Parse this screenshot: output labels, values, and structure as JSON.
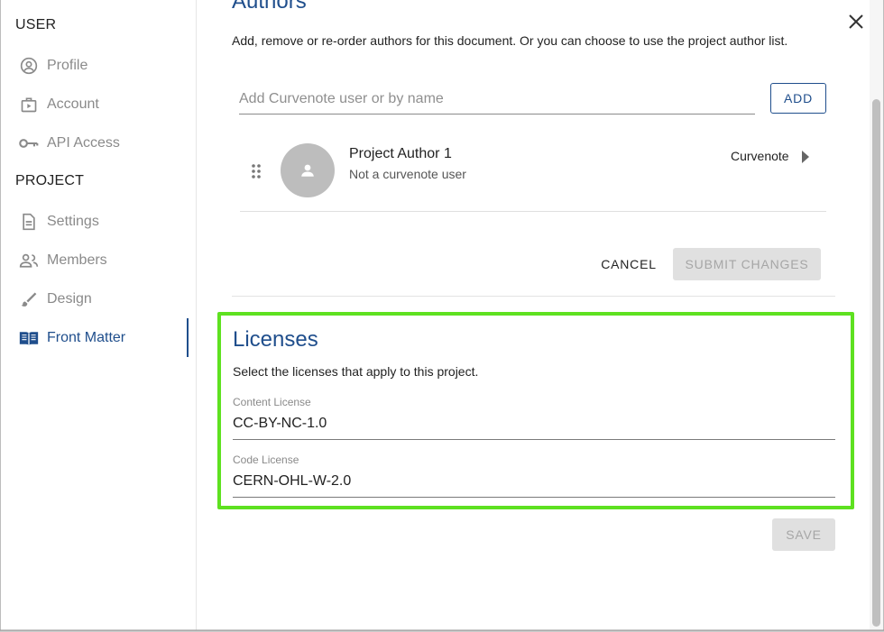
{
  "sidebar": {
    "user_title": "USER",
    "project_title": "PROJECT",
    "user_items": [
      {
        "label": "Profile",
        "icon": "account-circle-icon"
      },
      {
        "label": "Account",
        "icon": "briefcase-icon"
      },
      {
        "label": "API Access",
        "icon": "key-icon"
      }
    ],
    "project_items": [
      {
        "label": "Settings",
        "icon": "document-icon"
      },
      {
        "label": "Members",
        "icon": "people-icon"
      },
      {
        "label": "Design",
        "icon": "brush-icon"
      },
      {
        "label": "Front Matter",
        "icon": "book-icon",
        "active": true
      }
    ]
  },
  "authors": {
    "title": "Authors",
    "description": "Add, remove or re-order authors for this document. Or you can choose to use the project author list.",
    "input_placeholder": "Add Curvenote user or by name",
    "add_label": "ADD",
    "list": [
      {
        "name": "Project Author 1",
        "subtitle": "Not a curvenote user",
        "source": "Curvenote"
      }
    ],
    "cancel_label": "CANCEL",
    "submit_label": "SUBMIT CHANGES"
  },
  "licenses": {
    "title": "Licenses",
    "description": "Select the licenses that apply to this project.",
    "content_label": "Content License",
    "content_value": "CC-BY-NC-1.0",
    "code_label": "Code License",
    "code_value": "CERN-OHL-W-2.0",
    "save_label": "SAVE"
  },
  "colors": {
    "accent": "#1f4e8c",
    "highlight": "#5ee120",
    "muted": "#8a8a8a"
  }
}
